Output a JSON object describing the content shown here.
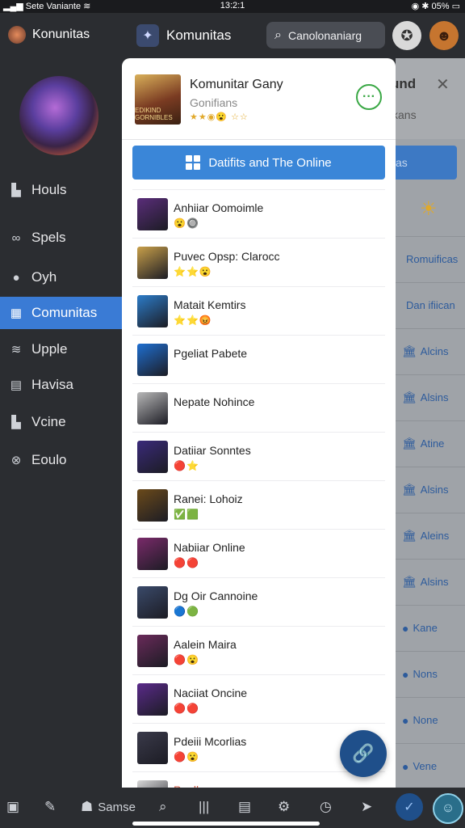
{
  "status": {
    "carrier": "Sete Vaniante",
    "time": "13:2:1",
    "battery": "05%"
  },
  "sidebar": {
    "title": "Konunitas",
    "items": [
      {
        "label": "Houls",
        "icon": "home-icon"
      },
      {
        "label": "Spels",
        "icon": "link-icon"
      },
      {
        "label": "Oyh",
        "icon": "user-icon"
      },
      {
        "label": "Comunitas",
        "icon": "grid-icon",
        "active": true
      },
      {
        "label": "Upple",
        "icon": "wifi-icon"
      },
      {
        "label": "Havisa",
        "icon": "calendar-icon"
      },
      {
        "label": "Vcine",
        "icon": "folder-icon"
      },
      {
        "label": "Eoulo",
        "icon": "compass-icon"
      }
    ]
  },
  "topbar": {
    "title": "Komunitas",
    "search_placeholder": "Canolonaniarg"
  },
  "card": {
    "title": "Komunitar Gany",
    "subtitle": "Gonifians",
    "thumb_text": "EDIKIND GORNIBLES",
    "action_label": "Datifits and The Online",
    "rows": [
      {
        "label": "Anhiiar Oomoimle",
        "badges": "😮🔘",
        "thumb": "#5a2d7a"
      },
      {
        "label": "Puvec Opsp: Clarocc",
        "badges": "⭐⭐😮",
        "thumb": "#c9a04a"
      },
      {
        "label": "Matait Kemtirs",
        "badges": "⭐⭐😡",
        "thumb": "#2c7cc9"
      },
      {
        "label": "Pgeliat Pabete",
        "badges": "",
        "thumb": "#1f6fd1"
      },
      {
        "label": "Nepate Nohince",
        "badges": "",
        "thumb": "#b8b8b8"
      },
      {
        "label": "Datiiar Sonntes",
        "badges": "🔴⭐",
        "thumb": "#3a2a7a"
      },
      {
        "label": "Ranei: Lohoiz",
        "badges": "✅🟩",
        "thumb": "#6b4a1a"
      },
      {
        "label": "Nabiiar Online",
        "badges": "🔴🔴",
        "thumb": "#7a2a6a"
      },
      {
        "label": "Dg Oir Cannoine",
        "badges": "🔵🟢",
        "thumb": "#3a4a6a"
      },
      {
        "label": "Aalein Maira",
        "badges": "🔴😮",
        "thumb": "#6a2a5a"
      },
      {
        "label": "Naciiat Oncine",
        "badges": "🔴🔴",
        "thumb": "#5a2a8a"
      },
      {
        "label": "Pdeiii Mcorlias",
        "badges": "🔴😮",
        "thumb": "#3a3a4a"
      },
      {
        "label": "Pnelke",
        "badges": "⭐😮",
        "thumb": "#d8d8d8",
        "label_color": "#d0553f"
      }
    ]
  },
  "bgpanel": {
    "title": "und",
    "subtitle": "kans",
    "button": "as",
    "rows": [
      {
        "label": "Romuificas",
        "icon": ""
      },
      {
        "label": "Dan ifiican",
        "icon": ""
      },
      {
        "label": "Alcins",
        "icon": "🏛"
      },
      {
        "label": "Alsins",
        "icon": "🏛"
      },
      {
        "label": "Atine",
        "icon": "🏛"
      },
      {
        "label": "Alsins",
        "icon": "🏛"
      },
      {
        "label": "Aleins",
        "icon": "🏛"
      },
      {
        "label": "Alsins",
        "icon": "🏛"
      },
      {
        "label": "Kane",
        "icon": "●"
      },
      {
        "label": "Nons",
        "icon": "●"
      },
      {
        "label": "None",
        "icon": "●"
      },
      {
        "label": "Vene",
        "icon": "●"
      }
    ]
  },
  "bottombar": {
    "label": "Samse"
  }
}
